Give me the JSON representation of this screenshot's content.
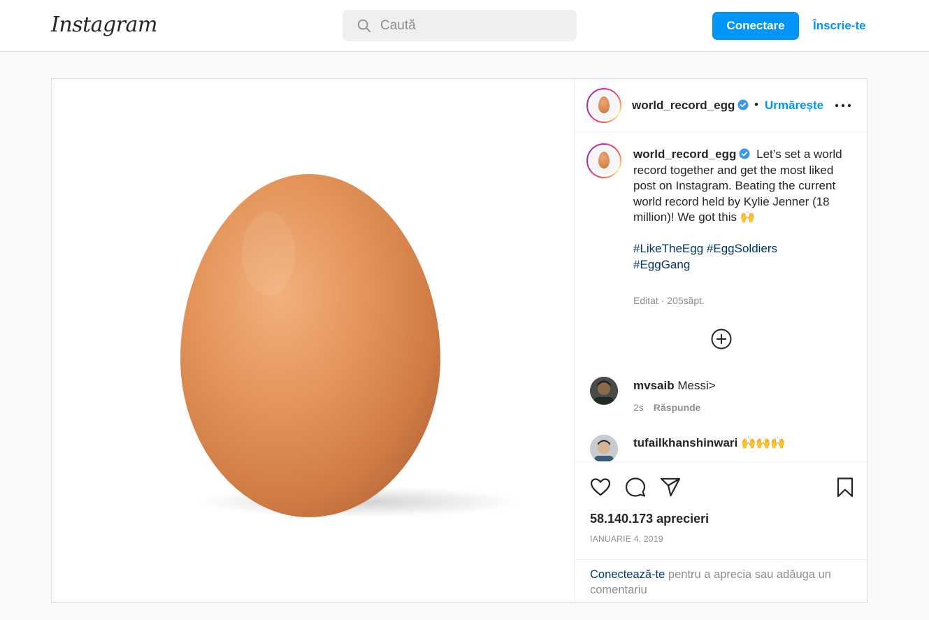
{
  "nav": {
    "logo": "Instagram",
    "search_placeholder": "Caută",
    "login_label": "Conectare",
    "signup_label": "Înscrie-te"
  },
  "colors": {
    "accent": "#0095f6",
    "link_dark": "#00376b",
    "muted": "#8e8e8e",
    "verified": "#3897f0"
  },
  "post": {
    "author": "world_record_egg",
    "verified": true,
    "separator": "•",
    "follow_label": "Urmărește",
    "more_icon": "more-horizontal-icon",
    "caption": {
      "username": "world_record_egg",
      "text": "Let’s set a world record together and get the most liked post on Instagram. Beating the current world record held by Kylie Jenner (18 million)! We got this 🙌",
      "hashtags": [
        "#LikeTheEgg",
        "#EggSoldiers",
        "#EggGang"
      ],
      "meta": "Editat · 205săpt."
    },
    "comments": [
      {
        "username": "mvsaib",
        "text": "Messi>",
        "time": "2s",
        "reply_label": "Răspunde"
      },
      {
        "username": "tufailkhanshinwari",
        "text": "🙌🙌🙌"
      }
    ],
    "likes": "58.140.173 aprecieri",
    "date": "IANUARIE 4, 2019",
    "login_prompt": {
      "link": "Conectează-te",
      "rest": " pentru a aprecia sau adăuga un comentariu"
    }
  }
}
